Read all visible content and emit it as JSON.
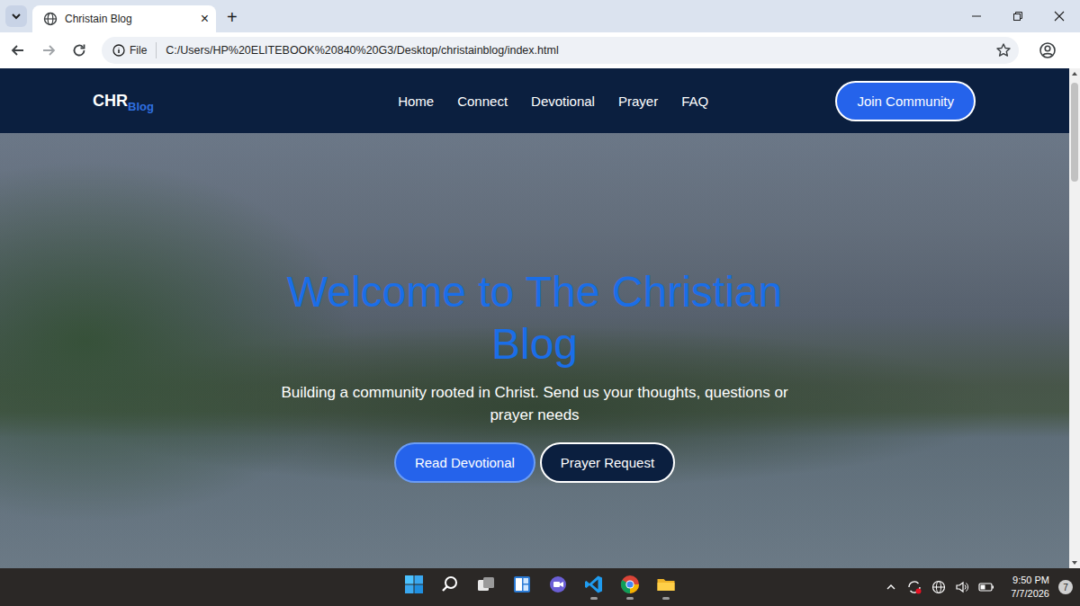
{
  "browser": {
    "tabs": [
      {
        "title": "Christain Blog",
        "close": "×",
        "selected": true
      }
    ],
    "new_tab": "+",
    "address_bar": {
      "scheme": "File",
      "url": "C:/Users/HP%20ELITEBOOK%20840%20G3/Desktop/christainblog/index.html"
    }
  },
  "page": {
    "logo": {
      "main": "CHR",
      "sub": "Blog"
    },
    "nav": [
      {
        "label": "Home"
      },
      {
        "label": "Connect"
      },
      {
        "label": "Devotional"
      },
      {
        "label": "Prayer"
      },
      {
        "label": "FAQ"
      }
    ],
    "cta": "Join Community",
    "hero": {
      "title": "Welcome to The Christian Blog",
      "subtitle": "Building a community rooted in Christ. Send us your thoughts, questions or prayer needs",
      "buttons": [
        {
          "label": "Read Devotional",
          "kind": "primary"
        },
        {
          "label": "Prayer Request",
          "kind": "secondary"
        }
      ]
    }
  },
  "taskbar": {
    "apps": [
      {
        "kind": "start",
        "running": false
      },
      {
        "kind": "search",
        "running": false
      },
      {
        "kind": "taskview",
        "running": false
      },
      {
        "kind": "widgets",
        "running": false
      },
      {
        "kind": "chat",
        "running": false
      },
      {
        "kind": "vscode",
        "running": true
      },
      {
        "kind": "chrome",
        "running": true
      },
      {
        "kind": "files",
        "running": true
      }
    ],
    "clock": {
      "time": "9:50 PM",
      "date": "7/7/2026"
    },
    "notifications": "7"
  }
}
